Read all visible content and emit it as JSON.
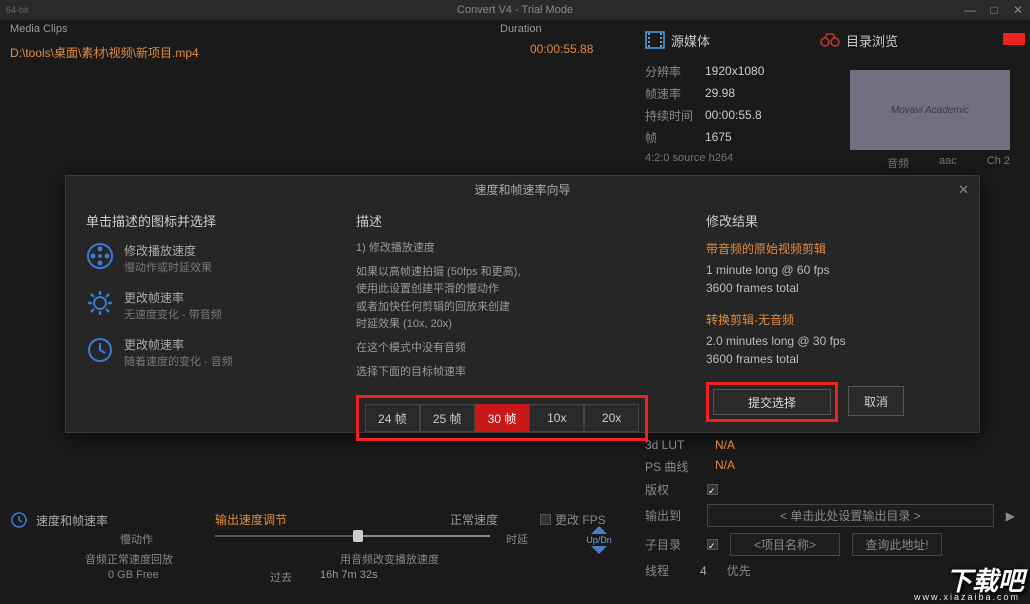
{
  "titlebar": {
    "badge": "64-bit",
    "title": "Convert V4 - Trial Mode",
    "min": "—",
    "max": "□",
    "close": "✕"
  },
  "header": {
    "media_clips": "Media Clips",
    "duration": "Duration"
  },
  "file": {
    "path": "D:\\tools\\桌面\\素材\\视频\\新项目.mp4",
    "duration": "00:00:55.88"
  },
  "right": {
    "src_media": "源媒体",
    "browse": "目录浏览",
    "resolution_lbl": "分辨率",
    "resolution": "1920x1080",
    "fps_lbl": "帧速率",
    "fps": "29.98",
    "dur_lbl": "持续时间",
    "dur": "00:00:55.8",
    "frames_lbl": "帧",
    "frames": "1675",
    "source_fmt": "4:2:0 source  h264",
    "audio_lbl": "音频",
    "audio_codec": "aac",
    "channels": "Ch 2",
    "thumb_text": "Movavi Academic"
  },
  "dialog": {
    "title": "速度和帧速率向导",
    "col1_heading": "单击描述的图标并选择",
    "opt1_title": "修改播放速度",
    "opt1_sub": "慢动作或时延效果",
    "opt2_title": "更改帧速率",
    "opt2_sub": "无速度变化 - 带音频",
    "opt3_title": "更改帧速率",
    "opt3_sub": "随着速度的变化 - 音频",
    "desc_heading": "描述",
    "desc_1": "1) 修改播放速度",
    "desc_2": "如果以高帧速拍摄 (50fps 和更高),",
    "desc_3": "使用此设置创建平滑的慢动作",
    "desc_4": "或者加快任何剪辑的回放来创建",
    "desc_5": "时延效果 (10x, 20x)",
    "desc_6": "在这个模式中没有音频",
    "desc_7": "选择下面的目标帧速率",
    "fps_opts": [
      "24 帧",
      "25 帧",
      "30 帧",
      "10x",
      "20x"
    ],
    "result_heading": "修改结果",
    "res1_title": "带音频的原始视频剪辑",
    "res1_l1": "1 minute long @ 60 fps",
    "res1_l2": "3600 frames total",
    "res2_title": "转换剪辑-无音频",
    "res2_l1": "2.0 minutes long @ 30 fps",
    "res2_l2": "3600 frames total",
    "submit": "提交选择",
    "cancel": "取消"
  },
  "bottom": {
    "panel_title": "速度和帧速率",
    "speed_adj": "输出速度调节",
    "normal": "正常速度",
    "chg_fps": "更改 FPS",
    "slow": "慢动作",
    "delay": "时延",
    "updn": "Up/Dn",
    "audio_norm": "音频正常速度回放",
    "audio_chg": "用音频改变播放速度",
    "gb_free": "0 GB Free",
    "past": "过去",
    "past_time": "16h 7m 32s"
  },
  "lower_right": {
    "lut3d_lbl": "3d LUT",
    "lut3d": "N/A",
    "ps_lbl": "PS 曲线",
    "ps": "N/A",
    "copyright_lbl": "版权",
    "out_lbl": "输出到",
    "out_val": "< 单击此处设置输出目录 >",
    "sub_lbl": "子目录",
    "sub_val": "<项目名称>",
    "subbtn": "查询此地址!",
    "thread_lbl": "线程",
    "thread_val": "4",
    "priority_lbl": "优先"
  },
  "watermark": {
    "main": "下载吧",
    "sub": "www.xiazaiba.com"
  }
}
